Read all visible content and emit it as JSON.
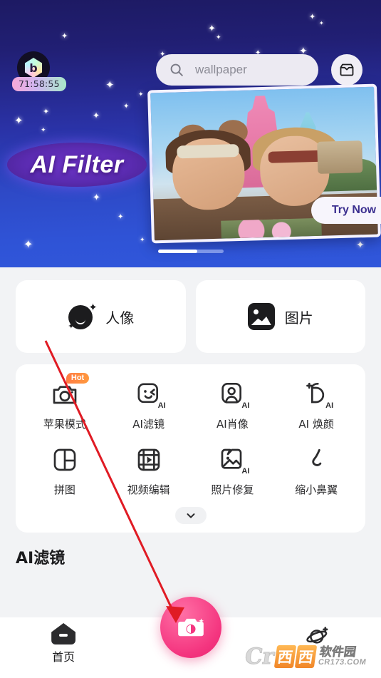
{
  "hero": {
    "app_badge_icon": "diamond-b-logo",
    "timer": "71:58:55",
    "logo_text": "AI Filter",
    "cta_label": "Try Now",
    "search": {
      "placeholder": "wallpaper",
      "icon": "search-icon"
    },
    "inbox_icon": "inbox-icon",
    "page_indicator": {
      "current": 1,
      "total": 2
    }
  },
  "top_cards": [
    {
      "label": "人像",
      "icon": "portrait-face-icon"
    },
    {
      "label": "图片",
      "icon": "picture-image-icon"
    }
  ],
  "tools": [
    {
      "label": "苹果模式",
      "icon": "camera-icon",
      "badge": "Hot",
      "ai": false
    },
    {
      "label": "AI滤镜",
      "icon": "smiley-face-icon",
      "ai": true
    },
    {
      "label": "AI肖像",
      "icon": "person-frame-icon",
      "ai": true
    },
    {
      "label": "AI 焕颜",
      "icon": "face-glow-icon",
      "ai": true
    },
    {
      "label": "拼图",
      "icon": "collage-grid-icon",
      "ai": false
    },
    {
      "label": "视频编辑",
      "icon": "film-play-icon",
      "ai": false
    },
    {
      "label": "照片修复",
      "icon": "photo-repair-icon",
      "ai": true
    },
    {
      "label": "缩小鼻翼",
      "icon": "nose-icon",
      "ai": false
    }
  ],
  "expand_icon": "chevron-down-icon",
  "section_title": "AI滤镜",
  "bottom_nav": {
    "items": [
      {
        "label": "首页",
        "icon": "home-icon",
        "active": true
      },
      {
        "label": "",
        "icon": "planet-sparkle-icon",
        "active": false
      }
    ],
    "camera_button_icon": "camera-shutter-icon"
  },
  "watermark": {
    "cr": "Cr",
    "box1": "西",
    "box2": "西",
    "cn": "软件园",
    "url": "CR173.COM"
  },
  "colors": {
    "hero_top": "#1d1a63",
    "hero_bottom": "#3057db",
    "accent_pink": "#f4357f",
    "hot_badge": "#ff7a45",
    "cta_text": "#3b2f8f",
    "annotation": "#e01b24"
  }
}
